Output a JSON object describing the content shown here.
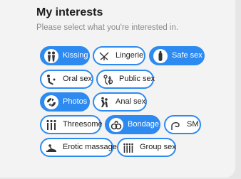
{
  "header": {
    "title": "My interests",
    "subtitle": "Please select what you're interested in."
  },
  "colors": {
    "accent": "#2d8af0",
    "chip_bg": "#ffffff",
    "card_bg": "#f3f3f3"
  },
  "interests": [
    {
      "label": "Kissing",
      "icon": "kissing-icon",
      "selected": true
    },
    {
      "label": "Lingerie",
      "icon": "lingerie-icon",
      "selected": false
    },
    {
      "label": "Safe sex",
      "icon": "condom-icon",
      "selected": true
    },
    {
      "label": "Oral sex",
      "icon": "oral-sex-icon",
      "selected": false
    },
    {
      "label": "Public sex",
      "icon": "public-sex-icon",
      "selected": false
    },
    {
      "label": "Photos",
      "icon": "photos-icon",
      "selected": true
    },
    {
      "label": "Anal sex",
      "icon": "anal-sex-icon",
      "selected": false
    },
    {
      "label": "Threesome",
      "icon": "threesome-icon",
      "selected": false
    },
    {
      "label": "Bondage",
      "icon": "handcuffs-icon",
      "selected": true
    },
    {
      "label": "SM",
      "icon": "whip-icon",
      "selected": false
    },
    {
      "label": "Erotic massage",
      "icon": "massage-icon",
      "selected": false
    },
    {
      "label": "Group sex",
      "icon": "group-sex-icon",
      "selected": false
    }
  ]
}
